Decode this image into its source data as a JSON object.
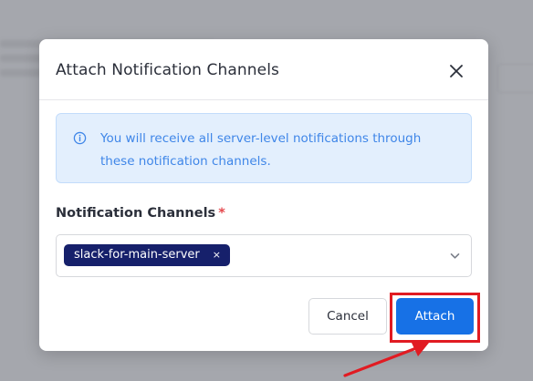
{
  "modal": {
    "title": "Attach Notification Channels",
    "info_message": "You will receive all server-level notifications through these notification channels.",
    "field_label": "Notification Channels",
    "required_marker": "*",
    "selected_channels": [
      "slack-for-main-server"
    ],
    "tag_remove_symbol": "×",
    "cancel_label": "Cancel",
    "attach_label": "Attach"
  },
  "icons": {
    "close": "close-icon",
    "info": "info-circle-icon",
    "dropdown": "chevron-down-icon"
  },
  "colors": {
    "primary": "#1771e6",
    "tag_background": "#16206b",
    "info_background": "#e3effd",
    "info_text": "#3f86e8",
    "required": "#e5484d",
    "annotation": "#e11b22"
  }
}
